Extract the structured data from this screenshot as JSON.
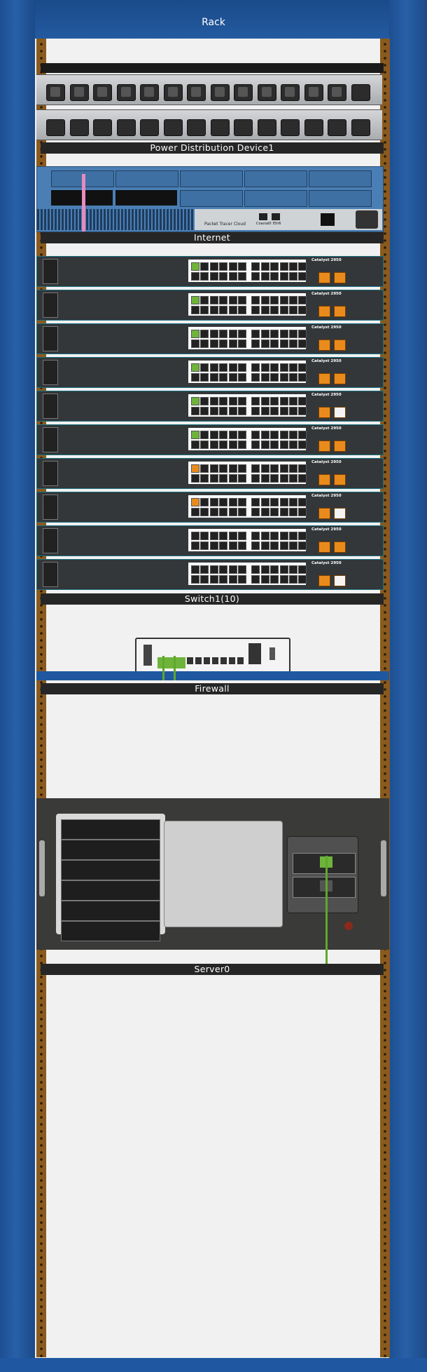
{
  "rack": {
    "title": "Rack"
  },
  "devices": {
    "pdu": {
      "label": "Power Distribution Device1"
    },
    "router": {
      "label": "Internet",
      "brand_text": "Packet Tracer Cloud",
      "port_labels": [
        "Coaxial0",
        "Eth6"
      ]
    },
    "switch": {
      "label": "Switch1(10)",
      "model_text": "Catalyst 2950"
    },
    "firewall": {
      "label": "Firewall"
    },
    "server": {
      "label": "Server0"
    }
  },
  "colors": {
    "rack_blue": "#1f58a0",
    "rail_brown": "#8a5a1e",
    "cable_green": "#5fa82c",
    "cable_orange": "#e98b1c",
    "cable_pink": "#e58bc1"
  }
}
